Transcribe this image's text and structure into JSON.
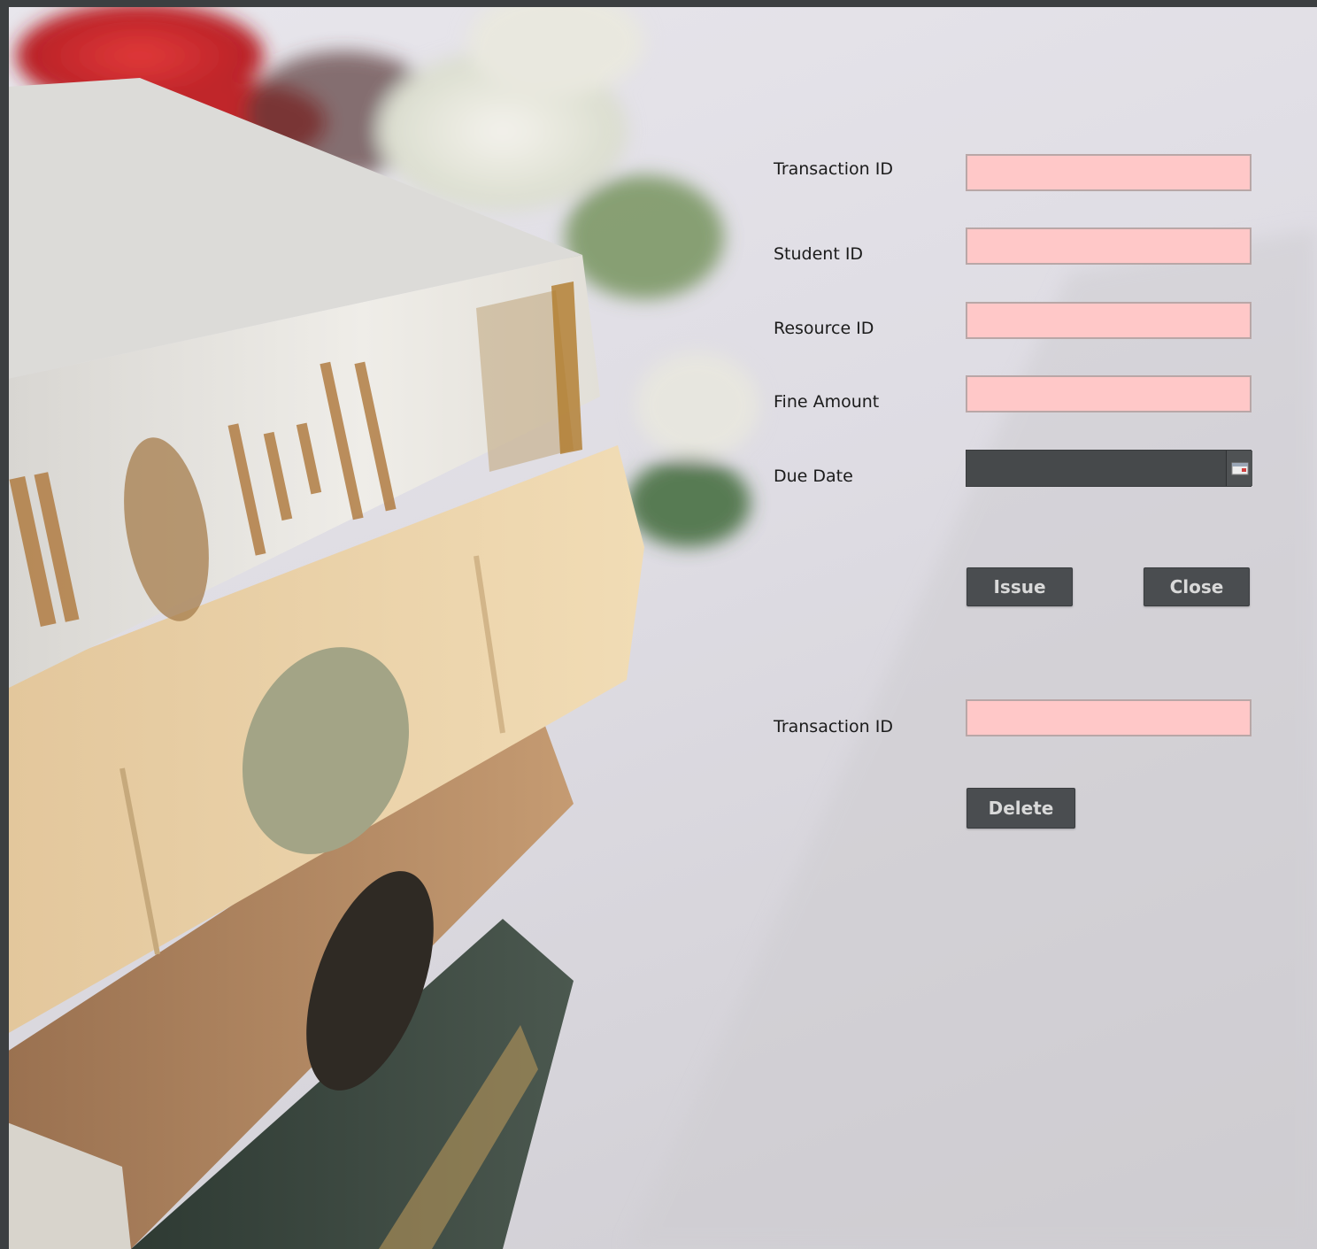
{
  "issue_form": {
    "transaction_id_label": "Transaction ID",
    "transaction_id_value": "",
    "student_id_label": "Student ID",
    "student_id_value": "",
    "resource_id_label": "Resource ID",
    "resource_id_value": "",
    "fine_amount_label": "Fine Amount",
    "fine_amount_value": "",
    "due_date_label": "Due Date",
    "due_date_value": "",
    "issue_button": "Issue",
    "close_button": "Close"
  },
  "delete_form": {
    "transaction_id_label": "Transaction ID",
    "transaction_id_value": "",
    "delete_button": "Delete"
  },
  "icons": {
    "date_picker": "calendar-icon"
  },
  "colors": {
    "field_background": "#ffc8c8",
    "button_background": "#4a4d50",
    "button_text": "#d9d9d9",
    "window_frame": "#3c3f41"
  }
}
